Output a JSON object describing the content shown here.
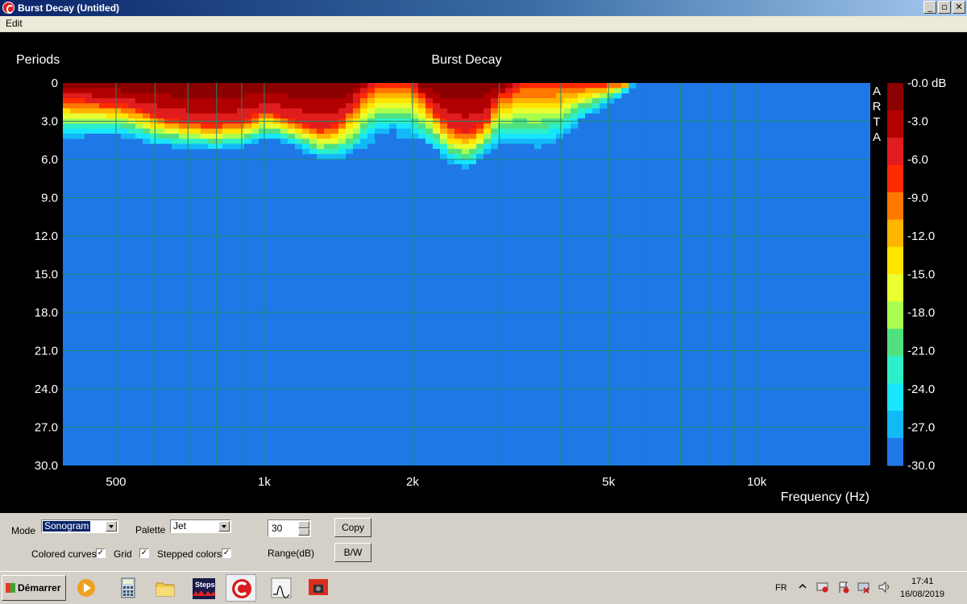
{
  "window": {
    "title": "Burst Decay  (Untitled)",
    "controls": {
      "minimize": "_",
      "maximize": "▫",
      "close": "✕"
    }
  },
  "menu": {
    "items": [
      "Edit"
    ]
  },
  "chart_data": {
    "type": "heatmap",
    "title": "Burst Decay",
    "ylabel": "Periods",
    "xlabel": "Frequency (Hz)",
    "side_label": "A R T A",
    "x_scale": "log",
    "xlim": [
      390,
      17000
    ],
    "ylim": [
      0,
      30
    ],
    "y_ticks": [
      "0",
      "3.0",
      "6.0",
      "9.0",
      "12.0",
      "15.0",
      "18.0",
      "21.0",
      "24.0",
      "27.0",
      "30.0"
    ],
    "x_ticks": [
      {
        "value": 500,
        "label": "500"
      },
      {
        "value": 1000,
        "label": "1k"
      },
      {
        "value": 2000,
        "label": "2k"
      },
      {
        "value": 5000,
        "label": "5k"
      },
      {
        "value": 10000,
        "label": "10k"
      }
    ],
    "grid_x": [
      500,
      600,
      700,
      800,
      900,
      1000,
      2000,
      3000,
      4000,
      5000,
      6000,
      7000,
      8000,
      9000,
      10000
    ],
    "grid_y": [
      3,
      6,
      9,
      12,
      15,
      18,
      21,
      24,
      27
    ],
    "grid": true,
    "colorbar": {
      "labels": [
        "-0.0 dB",
        "-3.0",
        "-6.0",
        "-9.0",
        "-12.0",
        "-15.0",
        "-18.0",
        "-21.0",
        "-24.0",
        "-27.0",
        "-30.0"
      ],
      "bands": [
        "#8b0000",
        "#b00000",
        "#e01c1c",
        "#ff2a00",
        "#ff7800",
        "#ffb400",
        "#ffe600",
        "#e9ff30",
        "#a8ff50",
        "#50e080",
        "#2cf0c8",
        "#18e6ff",
        "#12b8f8",
        "#1e78e6"
      ]
    },
    "background_level": -30,
    "decay": {
      "freq_hz": [
        390,
        450,
        500,
        550,
        600,
        700,
        800,
        900,
        1000,
        1100,
        1200,
        1300,
        1400,
        1500,
        1600,
        1700,
        1800,
        1900,
        2000,
        2200,
        2400,
        2600,
        2800,
        3000,
        3300,
        3600,
        4000,
        4400,
        4800,
        5200,
        5600,
        17000
      ],
      "periods_to_-30dB": [
        4.6,
        4.4,
        4.3,
        4.6,
        5.1,
        5.3,
        5.4,
        5.3,
        4.6,
        4.9,
        5.5,
        6.1,
        6.3,
        6.0,
        5.4,
        4.6,
        3.9,
        4.7,
        4.5,
        5.4,
        6.6,
        7.0,
        6.0,
        5.0,
        5.3,
        5.5,
        4.9,
        3.2,
        2.3,
        1.3,
        0.2,
        0.0
      ],
      "periods_to_-6dB": [
        1.2,
        1.4,
        1.6,
        1.9,
        2.5,
        3.1,
        3.2,
        3.0,
        2.2,
        2.6,
        3.2,
        3.6,
        3.3,
        2.0,
        0.4,
        0.0,
        0.0,
        0.0,
        0.0,
        2.0,
        3.5,
        3.8,
        3.0,
        1.0,
        0.0,
        0.0,
        0.0,
        0.0,
        0.0,
        0.0,
        0.0,
        0.0
      ]
    }
  },
  "controls": {
    "mode_label": "Mode",
    "mode_value": "Sonogram",
    "palette_label": "Palette",
    "palette_value": "Jet",
    "range_value": "30",
    "range_label": "Range(dB)",
    "copy_label": "Copy",
    "bw_label": "B/W",
    "colored_curves_label": "Colored curves",
    "grid_label": "Grid",
    "stepped_colors_label": "Stepped colors",
    "check_mark": "✓"
  },
  "taskbar": {
    "start_label": "Démarrer",
    "steps_label": "Steps",
    "language": "FR",
    "time": "17:41",
    "date": "16/08/2019",
    "icons": [
      "media-player-icon",
      "calculator-icon",
      "folder-icon",
      "steps-app-icon",
      "arta-app-icon",
      "limp-app-icon",
      "screenshot-tool-icon"
    ]
  }
}
